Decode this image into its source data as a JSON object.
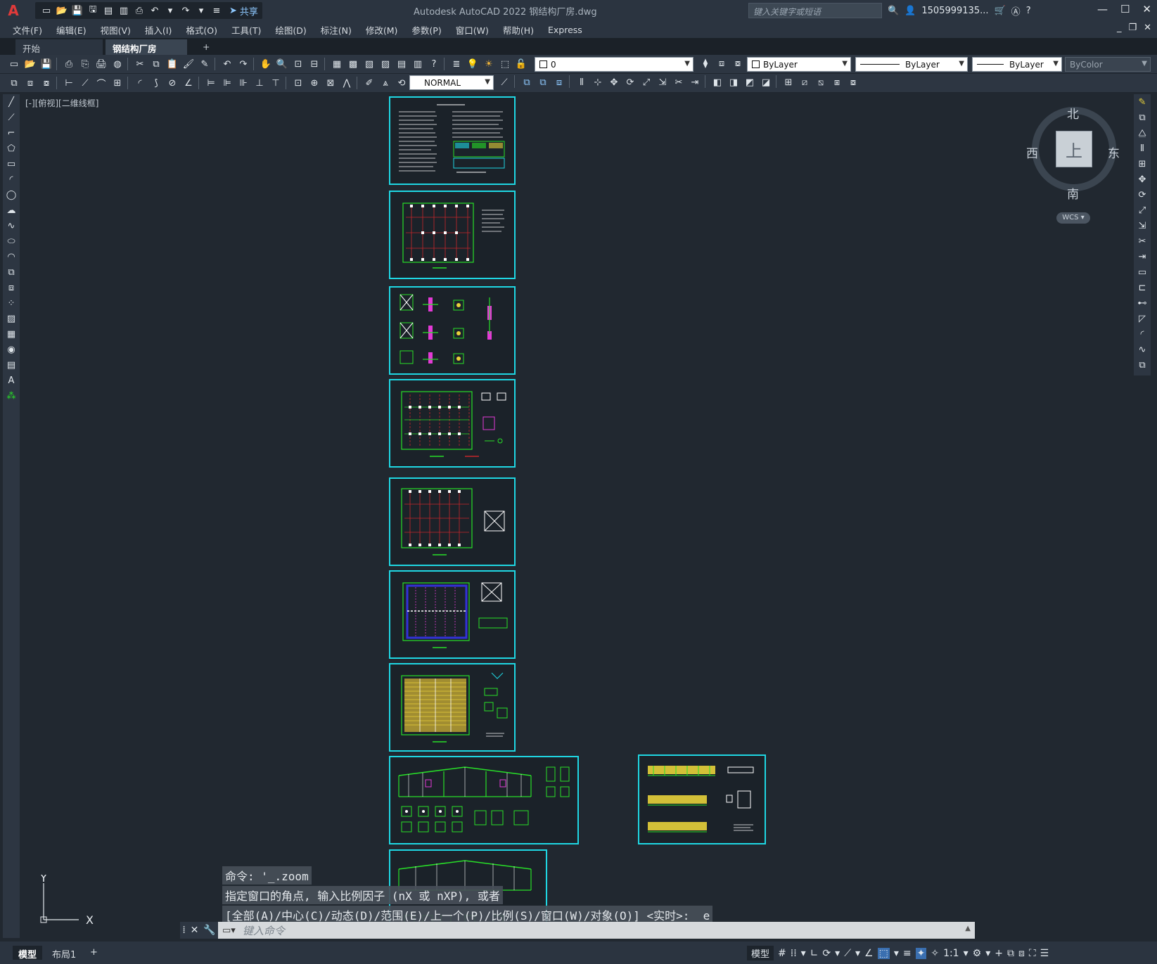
{
  "window": {
    "title": "Autodesk AutoCAD 2022    钢结构厂房.dwg",
    "search_placeholder": "键入关键字或短语",
    "user": "1505999135...",
    "share_label": "共享"
  },
  "menu": [
    "文件(F)",
    "编辑(E)",
    "视图(V)",
    "插入(I)",
    "格式(O)",
    "工具(T)",
    "绘图(D)",
    "标注(N)",
    "修改(M)",
    "参数(P)",
    "窗口(W)",
    "帮助(H)",
    "Express"
  ],
  "tabs": [
    {
      "label": "开始"
    },
    {
      "label": "钢结构厂房*"
    }
  ],
  "toolbar": {
    "layer_value": "0",
    "color_value": "ByLayer",
    "linetype_value": "ByLayer",
    "lineweight_value": "ByLayer",
    "plotstyle_value": "ByColor",
    "dimstyle_value": "NORMAL"
  },
  "viewport_label": "[-][俯视][二维线框]",
  "viewcube": {
    "face": "上",
    "north": "北",
    "south": "南",
    "east": "东",
    "west": "西",
    "wcs": "WCS"
  },
  "ucs": {
    "x": "X",
    "y": "Y"
  },
  "command": {
    "history": [
      "命令: '_.zoom",
      "指定窗口的角点, 输入比例因子 (nX 或 nXP), 或者",
      "[全部(A)/中心(C)/动态(D)/范围(E)/上一个(P)/比例(S)/窗口(W)/对象(O)] <实时>: _e"
    ],
    "placeholder": "键入命令"
  },
  "status": {
    "layouts": [
      "模型",
      "布局1"
    ],
    "model_label": "模型",
    "scale": "1:1"
  },
  "colors": {
    "sheet_border": "#1fd7e3",
    "green": "#28e028",
    "red": "#c8262a",
    "magenta": "#e33ad6",
    "yellow": "#e8d23a",
    "blue": "#3232d8",
    "background": "#212830"
  }
}
